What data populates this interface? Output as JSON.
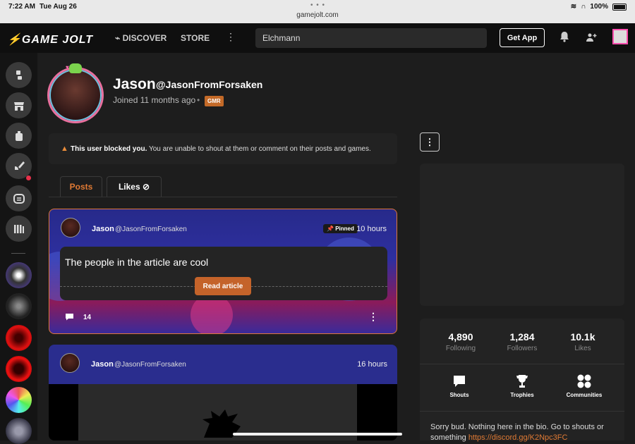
{
  "status_bar": {
    "time": "7:22 AM",
    "date": "Tue Aug 26",
    "url": "gamejolt.com",
    "battery": "100%"
  },
  "nav": {
    "logo": "GAME JOLT",
    "discover": "DISCOVER",
    "store": "STORE",
    "search_value": "Elchmann",
    "get_app": "Get App"
  },
  "profile": {
    "name": "Jason",
    "handle": "@JasonFromForsaken",
    "joined": "Joined 11 months ago",
    "badge": "GMR"
  },
  "blocked_notice": {
    "bold": "This user blocked you.",
    "text": " You are unable to shout at them or comment on their posts and games."
  },
  "tabs": {
    "posts": "Posts",
    "likes": "Likes"
  },
  "posts": [
    {
      "author": "Jason",
      "handle": "@JasonFromForsaken",
      "pinned": "Pinned",
      "time": "10 hours",
      "article_title": "The people in the article are cool",
      "read_button": "Read article",
      "comments": "14"
    },
    {
      "author": "Jason",
      "handle": "@JasonFromForsaken",
      "time": "16 hours"
    }
  ],
  "stats": {
    "following": {
      "value": "4,890",
      "label": "Following"
    },
    "followers": {
      "value": "1,284",
      "label": "Followers"
    },
    "likes": {
      "value": "10.1k",
      "label": "Likes"
    }
  },
  "quick_links": {
    "shouts": "Shouts",
    "trophies": "Trophies",
    "communities": "Communities"
  },
  "bio": {
    "text": "Sorry bud. Nothing here in the bio. Go to shouts or something ",
    "link": "https://discord.gg/K2Npc3FC"
  },
  "colors": {
    "accent": "#e07a34",
    "background": "#1d1d1d"
  }
}
